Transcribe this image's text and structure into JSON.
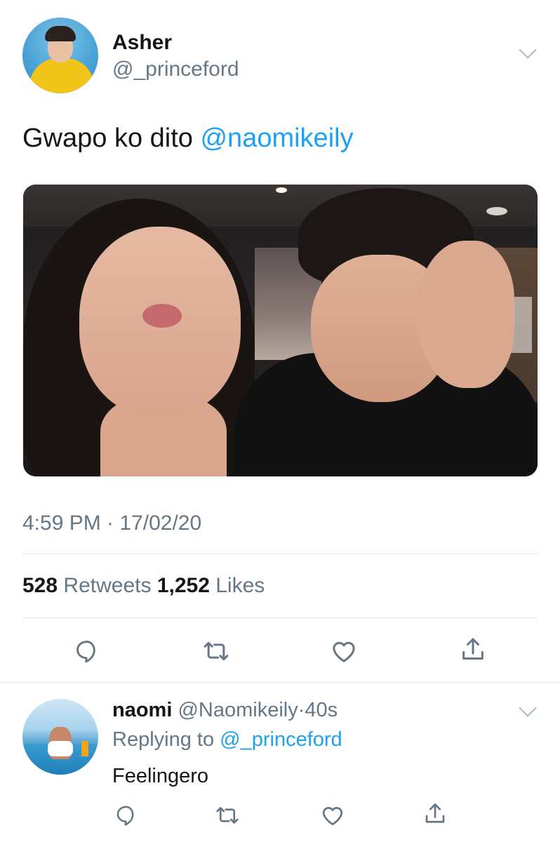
{
  "tweet": {
    "author": {
      "display_name": "Asher",
      "handle": "@_princeford",
      "avatar_icon": "avatar-photo"
    },
    "text": "Gwapo ko dito ",
    "mention": "@naomikeily",
    "photo_icon": "tweet-photo",
    "timestamp": "4:59 PM · 17/02/20",
    "stats": {
      "retweets_count": "528",
      "retweets_label": "Retweets",
      "likes_count": "1,252",
      "likes_label": "Likes"
    },
    "actions": [
      "reply-icon",
      "retweet-icon",
      "like-icon",
      "share-icon"
    ]
  },
  "reply": {
    "author": {
      "display_name": "naomi",
      "handle": "@Naomikeily",
      "separator": "·",
      "time": "40s",
      "avatar_icon": "avatar-photo"
    },
    "replying_to_label": "Replying to ",
    "replying_to_handle": "@_princeford",
    "text": "Feelingero",
    "actions": [
      "reply-icon",
      "retweet-icon",
      "like-icon",
      "share-icon"
    ]
  },
  "colors": {
    "link": "#1da1f2",
    "secondary_text": "#657786",
    "primary_text": "#14171a",
    "divider": "#e1e8ed",
    "icon": "#657786"
  }
}
